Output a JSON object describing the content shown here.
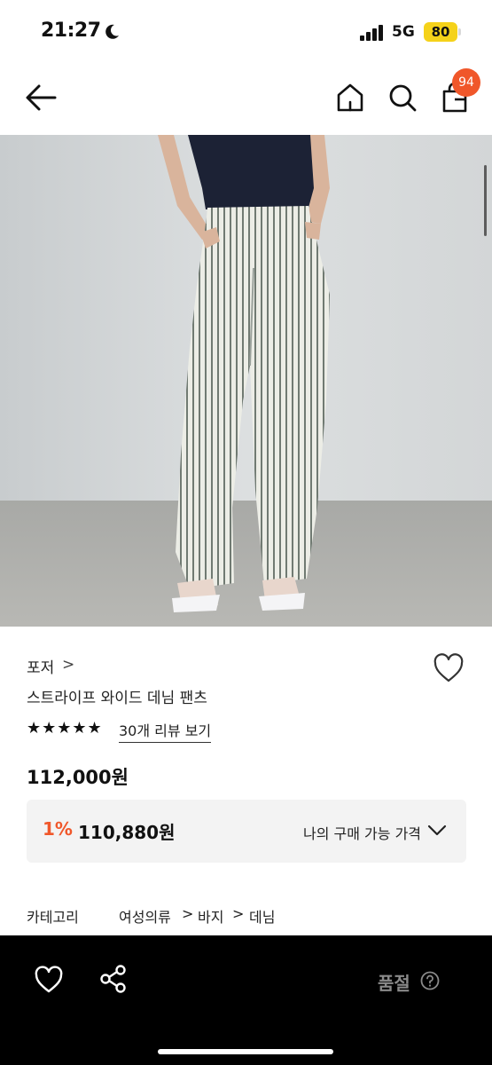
{
  "status_bar": {
    "time": "21:27",
    "network": "5G",
    "battery": "80"
  },
  "nav": {
    "cart_count": "94",
    "icons": [
      "back-arrow-icon",
      "home-icon",
      "search-icon",
      "shopping-bag-icon"
    ]
  },
  "product": {
    "brand": "포저",
    "brand_chevron": ">",
    "name": "스트라이프 와이드 데님 팬츠",
    "rating_stars": "★★★★★",
    "rating": 5,
    "review_link": "30개 리뷰 보기",
    "price": "112,000원",
    "purchase": {
      "discount": "1%",
      "price": "110,880원",
      "label": "나의 구매 가능 가격"
    },
    "category": {
      "label": "카테고리",
      "path": [
        "여성의류",
        "바지",
        "데님"
      ],
      "separator": ">"
    }
  },
  "bottom_bar": {
    "status": "품절",
    "icons": [
      "heart-icon",
      "share-icon",
      "help-icon"
    ]
  },
  "colors": {
    "accent": "#f0572a",
    "battery": "#f5d21a",
    "bottom_bar": "#000000",
    "buy_box": "#f3f3f3",
    "soldout_text": "#8a8a8a"
  }
}
